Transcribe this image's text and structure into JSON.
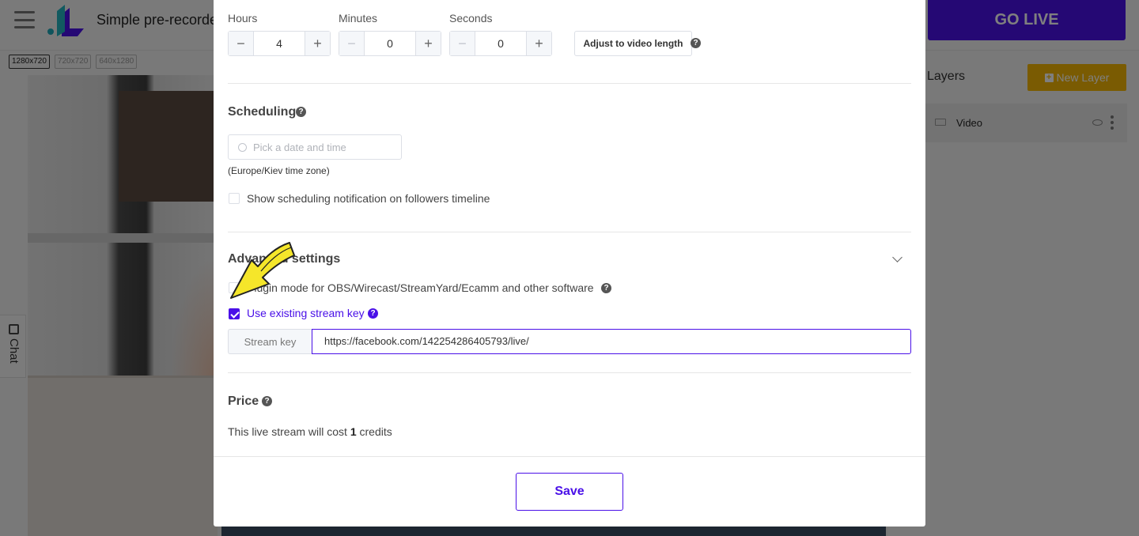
{
  "app": {
    "title": "Simple pre-recorde",
    "resolutions": [
      "1280x720",
      "720x720",
      "640x1280"
    ],
    "go_live_label": "GO LIVE",
    "chat_label": "Chat",
    "layers_title": "Layers",
    "new_layer_label": "New Layer",
    "layers": [
      {
        "name": "Video"
      }
    ]
  },
  "duration": {
    "hours_label": "Hours",
    "minutes_label": "Minutes",
    "seconds_label": "Seconds",
    "hours_value": "4",
    "minutes_value": "0",
    "seconds_value": "0",
    "minus_symbol": "−",
    "plus_symbol": "+",
    "adjust_label": "Adjust to video length"
  },
  "scheduling": {
    "title": "Scheduling",
    "date_placeholder": "Pick a date and time",
    "timezone": "(Europe/Kiev time zone)",
    "notify_label": "Show scheduling notification on followers timeline",
    "notify_checked": false
  },
  "advanced": {
    "title": "Advanced settings",
    "plugin_mode_label": "Plugin mode for OBS/Wirecast/StreamYard/Ecamm and other software",
    "plugin_mode_checked": false,
    "existing_key_label": "Use existing stream key",
    "existing_key_checked": true,
    "stream_key_label": "Stream key",
    "stream_key_value": "https://facebook.com/142254286405793/live/"
  },
  "price": {
    "title": "Price",
    "text_before": "This live stream will cost ",
    "credits": "1",
    "text_after": " credits"
  },
  "footer": {
    "save_label": "Save"
  },
  "help_symbol": "?",
  "colors": {
    "accent": "#4a10e8",
    "go_live": "#4a10e8",
    "new_layer": "#f5b705",
    "arrow": "#f5e62a"
  }
}
